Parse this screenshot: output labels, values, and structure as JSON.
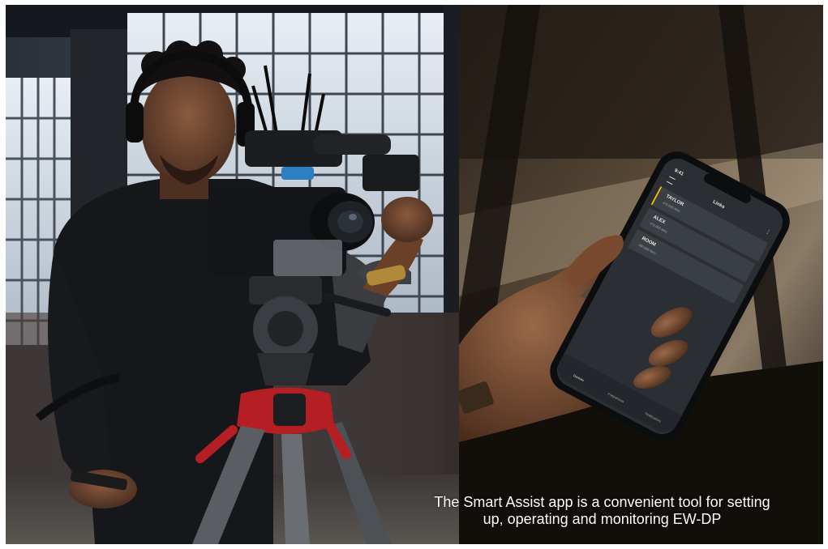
{
  "caption": {
    "line1": "The Smart Assist app is a convenient tool for setting",
    "line2": "up, operating and monitoring EW-DP"
  },
  "phone_screen": {
    "time": "9:41",
    "title": "Links",
    "channels": [
      {
        "name": "TAYLOR",
        "freq": "470.000 MHz"
      },
      {
        "name": "ALEX",
        "freq": "475.000 MHz"
      },
      {
        "name": "ROOM",
        "freq": "480.000 MHz"
      }
    ],
    "nav": [
      "Devices",
      "Frequencies",
      "Notifications"
    ]
  },
  "colors": {
    "screen_bg": "#2b2f33",
    "card_bg": "#3a3f44",
    "accent": "#f2c300"
  }
}
